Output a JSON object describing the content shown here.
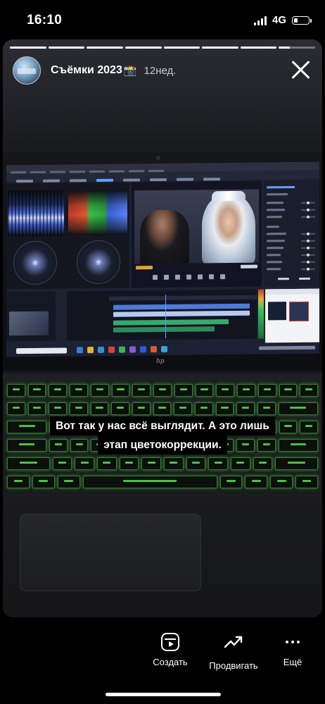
{
  "status_bar": {
    "time": "16:10",
    "network": "4G",
    "battery_level": 0.25
  },
  "story": {
    "progress_segments": [
      1,
      1,
      1,
      1,
      1,
      1,
      1,
      0.3
    ],
    "title": "Съёмки 2023",
    "title_emoji": "📸",
    "age": "12нед.",
    "caption_lines": [
      "Вот так у нас всё выглядит. А это лишь",
      "этап цветокоррекции."
    ]
  },
  "actions": {
    "create_label": "Создать",
    "promote_label": "Продвигать",
    "more_label": "Ещё"
  },
  "icons": {
    "close": "close-icon",
    "create": "reels-create-icon",
    "promote": "trend-up-icon",
    "more": "more-dots-icon"
  }
}
